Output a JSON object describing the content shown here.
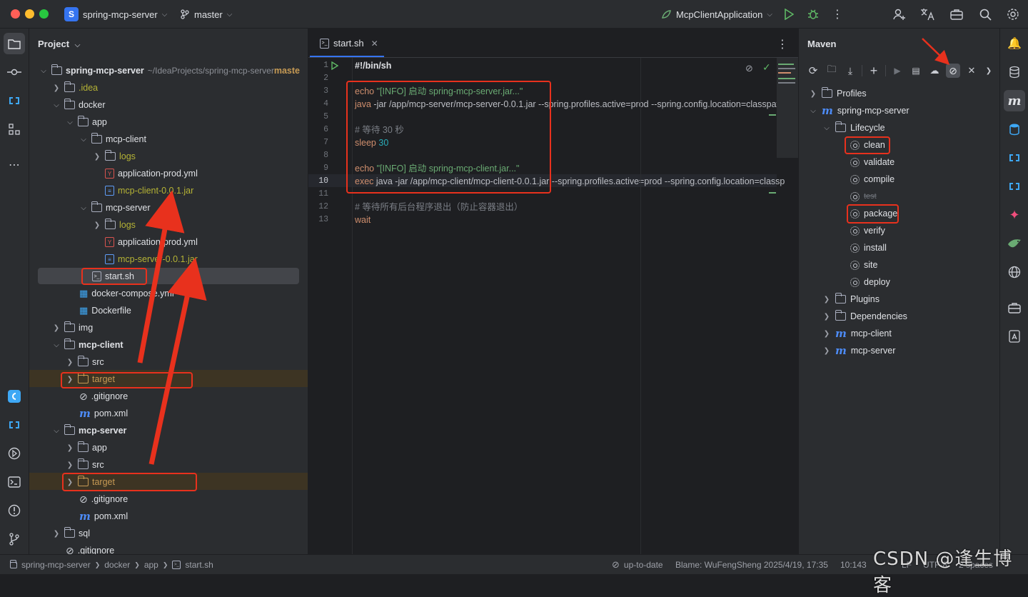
{
  "titlebar": {
    "project_badge": "S",
    "project_name": "spring-mcp-server",
    "branch": "master",
    "run_config": "McpClientApplication"
  },
  "project_panel": {
    "title": "Project",
    "tree": [
      {
        "label": "spring-mcp-server",
        "suffix": " ~/IdeaProjects/spring-mcp-server",
        "suffix2": "maste"
      },
      {
        "label": ".idea"
      },
      {
        "label": "docker"
      },
      {
        "label": "app"
      },
      {
        "label": "mcp-client"
      },
      {
        "label": "logs"
      },
      {
        "label": "application-prod.yml"
      },
      {
        "label": "mcp-client-0.0.1.jar"
      },
      {
        "label": "mcp-server"
      },
      {
        "label": "logs"
      },
      {
        "label": "application-prod.yml"
      },
      {
        "label": "mcp-server-0.0.1.jar"
      },
      {
        "label": "start.sh"
      },
      {
        "label": "docker-compose.yml"
      },
      {
        "label": "Dockerfile"
      },
      {
        "label": "img"
      },
      {
        "label": "mcp-client"
      },
      {
        "label": "src"
      },
      {
        "label": "target"
      },
      {
        "label": ".gitignore"
      },
      {
        "label": "pom.xml"
      },
      {
        "label": "mcp-server"
      },
      {
        "label": "app"
      },
      {
        "label": "src"
      },
      {
        "label": "target"
      },
      {
        "label": ".gitignore"
      },
      {
        "label": "pom.xml"
      },
      {
        "label": "sql"
      },
      {
        "label": ".gitignore"
      }
    ]
  },
  "editor": {
    "tab_label": "start.sh",
    "line_numbers": [
      "1",
      "2",
      "3",
      "4",
      "5",
      "6",
      "7",
      "8",
      "9",
      "10",
      "11",
      "12",
      "13"
    ],
    "lines": {
      "l1": "#!/bin/sh",
      "l3_kw": "echo",
      "l3_str": " \"[INFO] 启动 spring-mcp-server.jar...\"",
      "l4_kw": "java",
      "l4_rest": " -jar /app/mcp-server/mcp-server-0.0.1.jar --spring.profiles.active=prod --spring.config.location=classpath",
      "l6": "# 等待 30 秒",
      "l7_kw": "sleep",
      "l7_num": " 30",
      "l9_kw": "echo",
      "l9_str": " \"[INFO] 启动 spring-mcp-client.jar...\"",
      "l10_kw": "exec",
      "l10_rest": " java -jar /app/mcp-client/mcp-client-0.0.1.jar --spring.profiles.active=prod --spring.config.location=classp",
      "l12": "# 等待所有后台程序退出（防止容器退出）",
      "l13_kw": "wait"
    }
  },
  "maven_panel": {
    "title": "Maven",
    "items": {
      "profiles": "Profiles",
      "root": "spring-mcp-server",
      "lifecycle": "Lifecycle",
      "clean": "clean",
      "validate": "validate",
      "compile": "compile",
      "test": "test",
      "package": "package",
      "verify": "verify",
      "install": "install",
      "site": "site",
      "deploy": "deploy",
      "plugins": "Plugins",
      "dependencies": "Dependencies",
      "mcp_client": "mcp-client",
      "mcp_server": "mcp-server"
    }
  },
  "statusbar": {
    "crumb1": "spring-mcp-server",
    "crumb2": "docker",
    "crumb3": "app",
    "crumb4": "start.sh",
    "vcs": "up-to-date",
    "blame": "Blame: WuFengSheng 2025/4/19, 17:35",
    "position": "10:143",
    "line_sep": "LF",
    "encoding": "UTF-8",
    "indent": "2 spaces"
  },
  "watermark": "CSDN @逢生博客",
  "colors": {
    "annotation_red": "#e8311d",
    "accent": "#3574f0",
    "folder_orange": "#c69a54",
    "olive_text": "#b5b335"
  }
}
